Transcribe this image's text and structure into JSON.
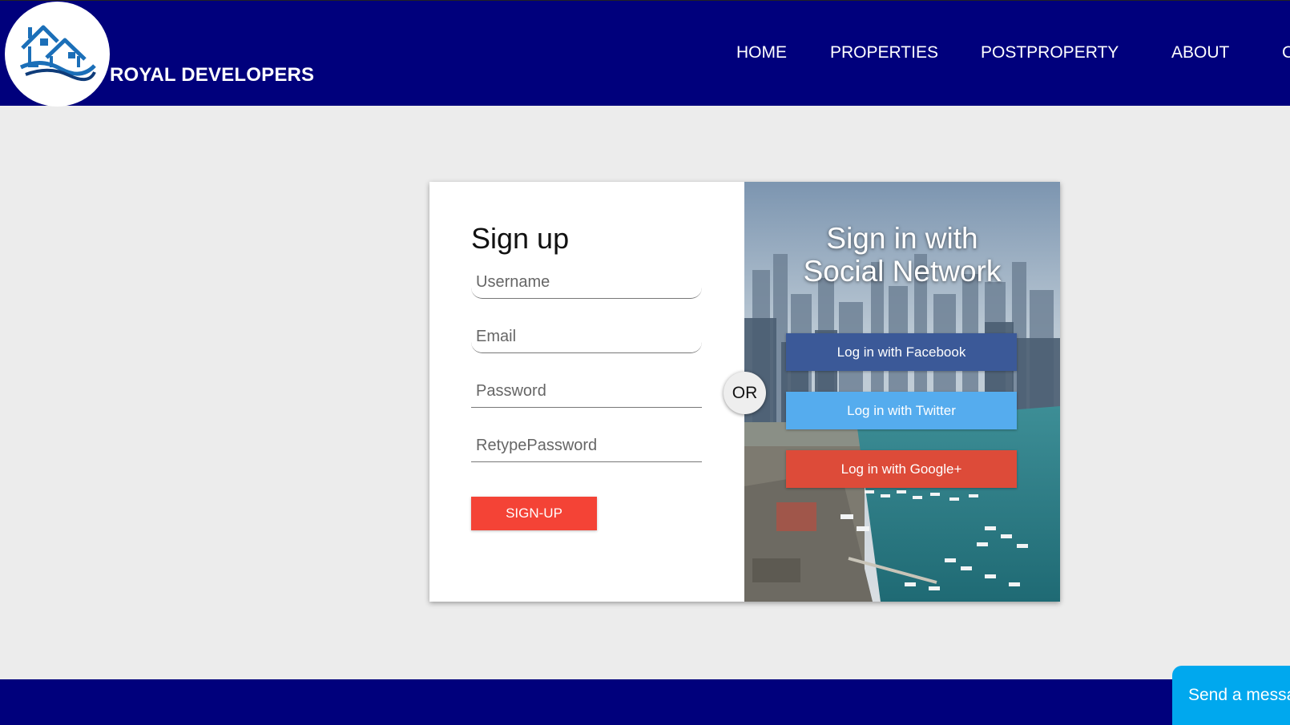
{
  "header": {
    "brand_name": "ROYAL DEVELOPERS",
    "logo_icon": "houses-logo-icon",
    "background_color": "#00007c",
    "nav": {
      "home": "HOME",
      "properties": "PROPERTIES",
      "post_property": "POSTPROPERTY",
      "about": "ABOUT",
      "more": "C"
    }
  },
  "signup": {
    "title": "Sign up",
    "username_placeholder": "Username",
    "email_placeholder": "Email",
    "password_placeholder": "Password",
    "retype_password_placeholder": "RetypePassword",
    "submit_label": "SIGN-UP",
    "submit_color": "#f44336"
  },
  "divider": {
    "label": "OR"
  },
  "social": {
    "title_line1": "Sign in with",
    "title_line2": "Social Network",
    "facebook_label": "Log in with Facebook",
    "twitter_label": "Log in with Twitter",
    "google_label": "Log in with Google+",
    "facebook_color": "#3b5998",
    "twitter_color": "#55acee",
    "google_color": "#dd4b39"
  },
  "chat": {
    "label": "Send a messa"
  }
}
